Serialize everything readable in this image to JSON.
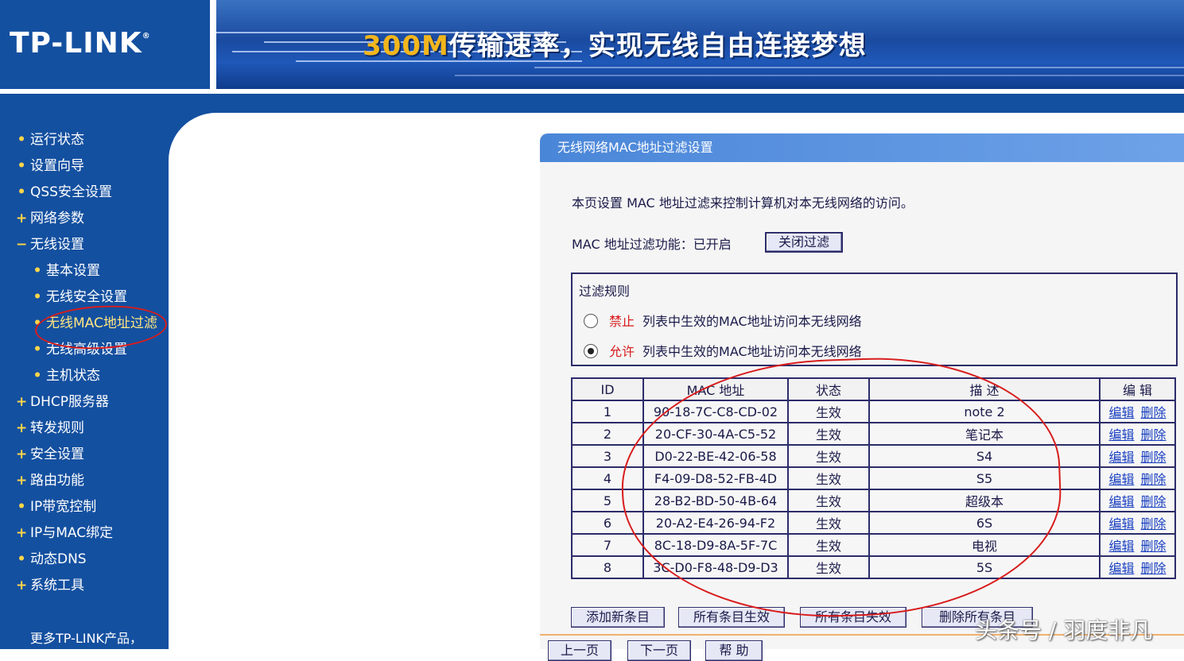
{
  "header": {
    "logo": "TP-LINK",
    "logo_reg": "®",
    "banner_highlight": "300M",
    "banner_text": "传输速率，实现无线自由连接梦想"
  },
  "sidebar": {
    "items": [
      {
        "label": "运行状态",
        "mark": "•"
      },
      {
        "label": "设置向导",
        "mark": "•"
      },
      {
        "label": "QSS安全设置",
        "mark": "•"
      },
      {
        "label": "网络参数",
        "mark": "+"
      },
      {
        "label": "无线设置",
        "mark": "−"
      },
      {
        "label": "基本设置",
        "mark": "•"
      },
      {
        "label": "无线安全设置",
        "mark": "•"
      },
      {
        "label": "无线MAC地址过滤",
        "mark": "•"
      },
      {
        "label": "无线高级设置",
        "mark": "•"
      },
      {
        "label": "主机状态",
        "mark": "•"
      },
      {
        "label": "DHCP服务器",
        "mark": "+"
      },
      {
        "label": "转发规则",
        "mark": "+"
      },
      {
        "label": "安全设置",
        "mark": "+"
      },
      {
        "label": "路由功能",
        "mark": "+"
      },
      {
        "label": "IP带宽控制",
        "mark": "•"
      },
      {
        "label": "IP与MAC绑定",
        "mark": "+"
      },
      {
        "label": "动态DNS",
        "mark": "•"
      },
      {
        "label": "系统工具",
        "mark": "+"
      }
    ],
    "more": "更多TP-LINK产品，"
  },
  "panel": {
    "title": "无线网络MAC地址过滤设置",
    "description": "本页设置 MAC 地址过滤来控制计算机对本无线网络的访问。",
    "filter_status": "MAC 地址过滤功能：已开启",
    "close_filter_button": "关闭过滤",
    "rules": {
      "title": "过滤规则",
      "deny_keyword": "禁止",
      "deny_text": "列表中生效的MAC地址访问本无线网络",
      "allow_keyword": "允许",
      "allow_text": "列表中生效的MAC地址访问本无线网络"
    },
    "table": {
      "headers": [
        "ID",
        "MAC 地址",
        "状态",
        "描 述",
        "编 辑"
      ],
      "edit_label": "编辑",
      "delete_label": "删除",
      "rows": [
        {
          "id": "1",
          "mac": "90-18-7C-C8-CD-02",
          "status": "生效",
          "desc": "note 2"
        },
        {
          "id": "2",
          "mac": "20-CF-30-4A-C5-52",
          "status": "生效",
          "desc": "笔记本"
        },
        {
          "id": "3",
          "mac": "D0-22-BE-42-06-58",
          "status": "生效",
          "desc": "S4"
        },
        {
          "id": "4",
          "mac": "F4-09-D8-52-FB-4D",
          "status": "生效",
          "desc": "S5"
        },
        {
          "id": "5",
          "mac": "28-B2-BD-50-4B-64",
          "status": "生效",
          "desc": "超级本"
        },
        {
          "id": "6",
          "mac": "20-A2-E4-26-94-F2",
          "status": "生效",
          "desc": "6S"
        },
        {
          "id": "7",
          "mac": "8C-18-D9-8A-5F-7C",
          "status": "生效",
          "desc": "电视"
        },
        {
          "id": "8",
          "mac": "3C-D0-F8-48-D9-D3",
          "status": "生效",
          "desc": "5S"
        }
      ]
    },
    "buttons": {
      "add": "添加新条目",
      "enable_all": "所有条目生效",
      "disable_all": "所有条目失效",
      "delete_all": "删除所有条目",
      "prev": "上一页",
      "next": "下一页",
      "help": "帮 助"
    }
  },
  "watermark": "头条号 / 羽度非凡"
}
